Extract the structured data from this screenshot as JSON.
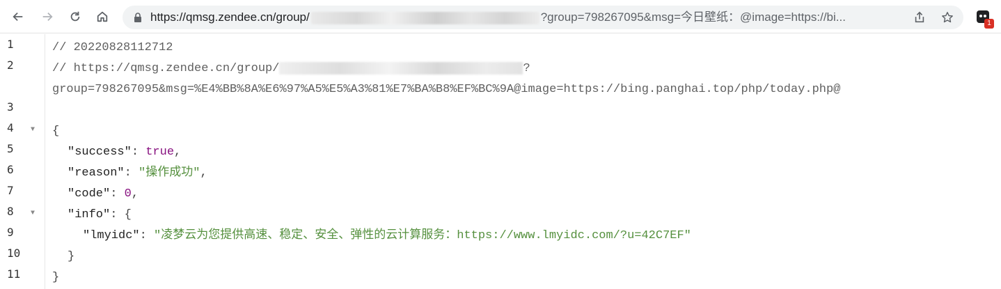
{
  "browser": {
    "url_prefix": "https://qmsg.zendee.cn/group/",
    "url_suffix": "?group=798267095&msg=今日壁纸：@image=https://bi..."
  },
  "extension": {
    "badge": "1"
  },
  "code": {
    "line_numbers": [
      "1",
      "2",
      "",
      "3",
      "4",
      "5",
      "6",
      "7",
      "8",
      "9",
      "10",
      "11"
    ],
    "l1": "// 20220828112712",
    "l2_prefix": "// https://qmsg.zendee.cn/group/",
    "l2_suffix": "?",
    "l2b": "group=798267095&msg=%E4%BB%8A%E6%97%A5%E5%A3%81%E7%BA%B8%EF%BC%9A@image=https://bing.panghai.top/php/today.php@",
    "brace_open": "{",
    "success_key": "\"success\"",
    "success_val": "true",
    "reason_key": "\"reason\"",
    "reason_val": "\"操作成功\"",
    "code_key": "\"code\"",
    "code_val": "0",
    "info_key": "\"info\"",
    "lmyidc_key": "\"lmyidc\"",
    "lmyidc_val": "\"凌梦云为您提供高速、稳定、安全、弹性的云计算服务：https://www.lmyidc.com/?u=42C7EF\"",
    "inner_close": "}",
    "brace_close": "}"
  }
}
